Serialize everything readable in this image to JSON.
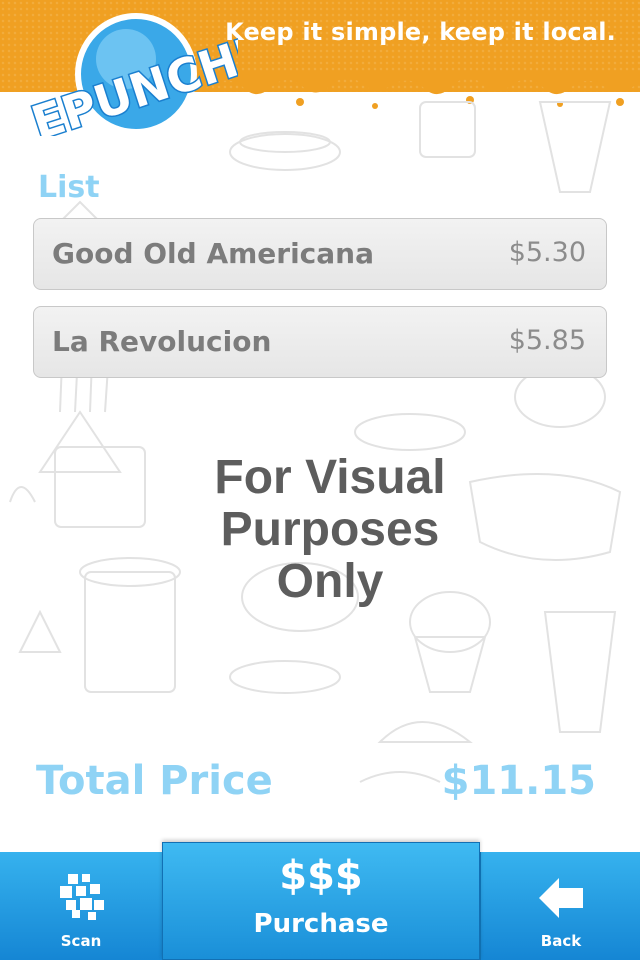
{
  "header": {
    "logo_text": "EPUNCHIT",
    "tagline": "Keep it simple, keep it local.",
    "color": "#f0a022"
  },
  "list": {
    "label": "List",
    "items": [
      {
        "name": "Good Old Americana",
        "price": "$5.30"
      },
      {
        "name": "La Revolucion",
        "price": "$5.85"
      }
    ]
  },
  "overlay": {
    "line1": "For Visual",
    "line2": "Purposes",
    "line3": "Only"
  },
  "total": {
    "label": "Total Price",
    "value": "$11.15",
    "color": "#8fd3f5"
  },
  "tabbar": {
    "scan": {
      "label": "Scan",
      "icon": "qr-code-icon"
    },
    "purchase": {
      "symbol": "$$$",
      "label": "Purchase"
    },
    "back": {
      "label": "Back",
      "icon": "arrow-left-icon"
    },
    "color": "#1a9be0"
  }
}
